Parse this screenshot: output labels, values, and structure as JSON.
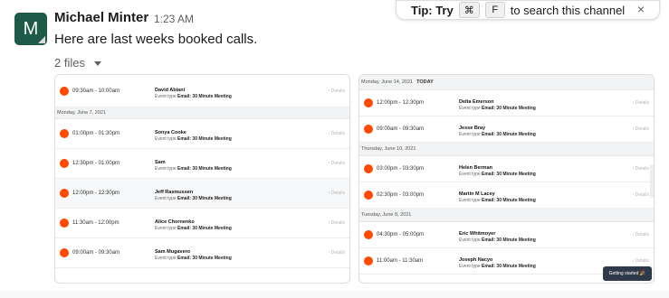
{
  "message": {
    "avatar_letter": "M",
    "sender": "Michael Minter",
    "time": "1:23 AM",
    "text": "Here are last weeks booked calls.",
    "files_label": "2 files"
  },
  "tip": {
    "prefix": "Tip: Try",
    "key1": "⌘",
    "key2": "F",
    "suffix": "to search this channel",
    "close": "×"
  },
  "file1": {
    "top_row": {
      "time": "09:30am - 10:00am",
      "name": "David Abiani",
      "etype_prefix": "Event type",
      "etype": "Email: 30 Minute Meeting",
      "details": "› Details"
    },
    "day_header": "Monday, June 7, 2021",
    "rows": [
      {
        "time": "01:00pm - 01:30pm",
        "name": "Sonya Cooke",
        "etype_prefix": "Event type",
        "etype": "Email: 30 Minute Meeting",
        "details": "› Details"
      },
      {
        "time": "12:30pm - 01:00pm",
        "name": "Sam",
        "etype_prefix": "Event type",
        "etype": "Email: 30 Minute Meeting",
        "details": "› Details"
      },
      {
        "time": "12:00pm - 12:30pm",
        "name": "Jeff Rasmussen",
        "etype_prefix": "Event type",
        "etype": "Email: 30 Minute Meeting",
        "details": "› Details"
      },
      {
        "time": "11:30am - 12:00pm",
        "name": "Alice Chornenko",
        "etype_prefix": "Event type",
        "etype": "Email: 30 Minute Meeting",
        "details": "› Details"
      },
      {
        "time": "09:00am - 09:30am",
        "name": "Sam Mugavero",
        "etype_prefix": "Event type",
        "etype": "Email: 30 Minute Meeting",
        "details": "› Details"
      }
    ]
  },
  "file2": {
    "day1": {
      "date": "Monday, June 14, 2021",
      "badge": "TODAY"
    },
    "day1_rows": [
      {
        "time": "12:00pm - 12:30pm",
        "name": "Delta Emerson",
        "etype_prefix": "Event type",
        "etype": "Email: 30 Minute Meeting",
        "details": "› Details"
      },
      {
        "time": "09:00am - 09:30am",
        "name": "Jesse Bray",
        "etype_prefix": "Event type",
        "etype": "Email: 30 Minute Meeting",
        "details": "› Details"
      }
    ],
    "day2": "Thursday, June 10, 2021",
    "day2_rows": [
      {
        "time": "03:00pm - 03:30pm",
        "name": "Helen Berman",
        "etype_prefix": "Event type",
        "etype": "Email: 30 Minute Meeting",
        "details": "› Details"
      },
      {
        "time": "02:30pm - 03:00pm",
        "name": "Martin M Lacey",
        "etype_prefix": "Event type",
        "etype": "Email: 30 Minute Meeting",
        "details": "› Details"
      }
    ],
    "day3": "Tuesday, June 8, 2021",
    "day3_rows": [
      {
        "time": "04:30pm - 05:00pm",
        "name": "Eric Whitmoyer",
        "etype_prefix": "Event type",
        "etype": "Email: 30 Minute Meeting",
        "details": "› Details"
      },
      {
        "time": "11:00am - 11:30am",
        "name": "Joseph Nacyo",
        "etype_prefix": "Event type",
        "etype": "Email: 30 Minute Meeting",
        "details": "› Details"
      }
    ],
    "getting_started": "Getting started 🎉"
  },
  "colors": {
    "accent_dot": "#ff4a00",
    "avatar_bg": "#1f5a48"
  }
}
